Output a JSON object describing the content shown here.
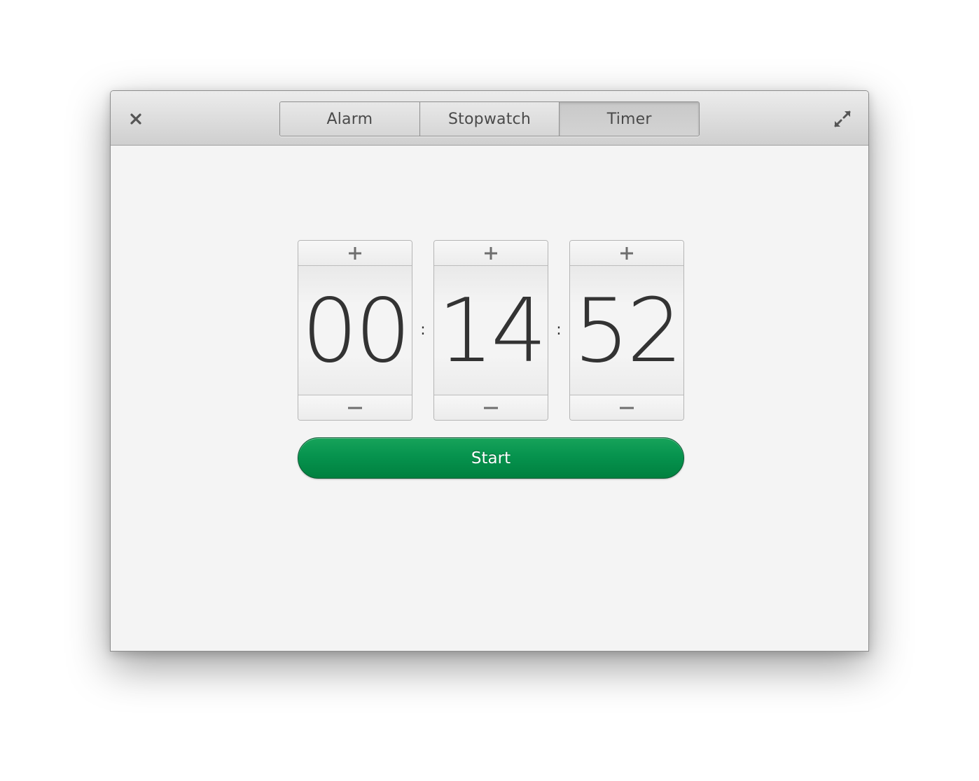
{
  "header": {
    "tabs": [
      {
        "label": "Alarm",
        "active": false
      },
      {
        "label": "Stopwatch",
        "active": false
      },
      {
        "label": "Timer",
        "active": true
      }
    ],
    "close_icon": "close-icon",
    "maximize_icon": "maximize-icon"
  },
  "timer": {
    "hours": "00",
    "minutes": "14",
    "seconds": "52",
    "separator": ":",
    "increment_icon": "plus-icon",
    "decrement_icon": "minus-icon"
  },
  "start_button": {
    "label": "Start",
    "color": "#069350"
  }
}
